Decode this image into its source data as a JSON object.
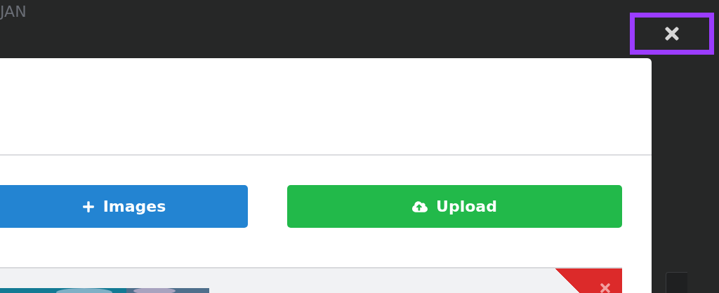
{
  "header": {
    "title": "JAN"
  },
  "modal": {
    "buttons": [
      {
        "kind": "add",
        "label": "Images"
      },
      {
        "kind": "upload",
        "label": "Upload"
      }
    ]
  }
}
